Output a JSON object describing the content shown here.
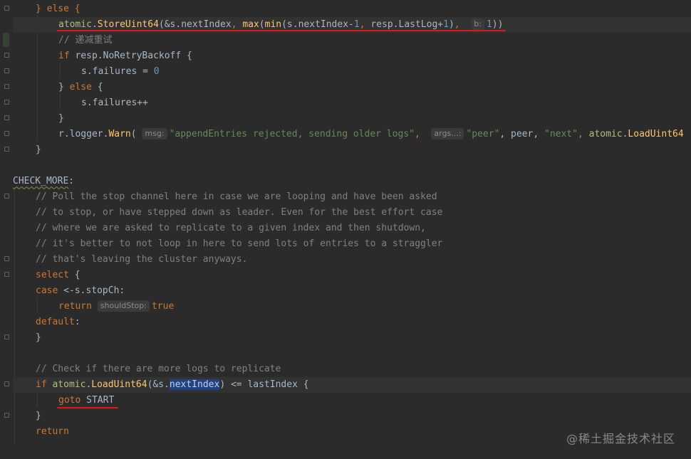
{
  "code": {
    "l1_else": "} else {",
    "l2_pkg": "atomic",
    "l2_fn": "StoreUint64",
    "l2_a": "(&s.",
    "l2_b": "nextIndex",
    "l2_c": ", ",
    "l2_max": "max",
    "l2_d": "(",
    "l2_min": "min",
    "l2_e": "(s.",
    "l2_f": "nextIndex",
    "l2_g": "-",
    "l2_one": "1",
    "l2_h": ", resp.LastLog+",
    "l2_one2": "1",
    "l2_i": "),",
    "l2_hint_b": "b:",
    "l2_one3": "1",
    "l2_j": "))",
    "l3_comment": "// 递减重试",
    "l4_if": "if",
    "l4_rest": " resp.NoRetryBackoff {",
    "l5_text": "s.failures = ",
    "l5_zero": "0",
    "l6_close": "} ",
    "l6_else": "else",
    "l6_brace": " {",
    "l7_text": "s.failures++",
    "l8_close": "}",
    "l9_r": "r.logger.",
    "l9_warn": "Warn",
    "l9_paren": "(",
    "l9_hint_msg": "msg:",
    "l9_msg": "\"appendEntries rejected, sending older logs\"",
    "l9_comma": ", ",
    "l9_hint_args": "args...:",
    "l9_peer_s": "\"peer\"",
    "l9_peer_v": ", peer, ",
    "l9_next_s": "\"next\"",
    "l9_comma2": ", ",
    "l9_atomic": "atomic",
    "l9_dot": ".",
    "l9_load": "LoadUint64",
    "l10_close": "}",
    "label": "CHECK_MORE",
    "label_colon": ":",
    "c1": "// Poll the stop channel here in case we are looping and have been asked",
    "c2": "// to stop, or have stepped down as leader. Even for the best effort case",
    "c3": "// where we are asked to replicate to a given index and then shutdown,",
    "c4": "// it's better to not loop in here to send lots of entries to a straggler",
    "c5": "// that's leaving the cluster anyways.",
    "select": "select",
    "select_brace": " {",
    "case": "case",
    "case_rest": " <-s.stopCh:",
    "return1": "return",
    "hint_should": "shouldStop:",
    "true": "true",
    "default": "default",
    "default_colon": ":",
    "close2": "}",
    "c6": "// Check if there are more logs to replicate",
    "if2": "if",
    "if2_pkg": "atomic",
    "if2_dot": ".",
    "if2_fn": "LoadUint64",
    "if2_a": "(&s.",
    "if2_sel": "nextIndex",
    "if2_b": ") <= lastIndex {",
    "goto": "goto",
    "goto_target": " START",
    "close3": "}",
    "return2": "return"
  },
  "watermark": "@稀土掘金技术社区",
  "colors": {
    "background": "#2b2b2b",
    "keyword": "#cc7832",
    "function": "#ffc66d",
    "string": "#6a8759",
    "number": "#6897bb",
    "comment": "#808080",
    "annotation_underline": "#e0161d"
  }
}
